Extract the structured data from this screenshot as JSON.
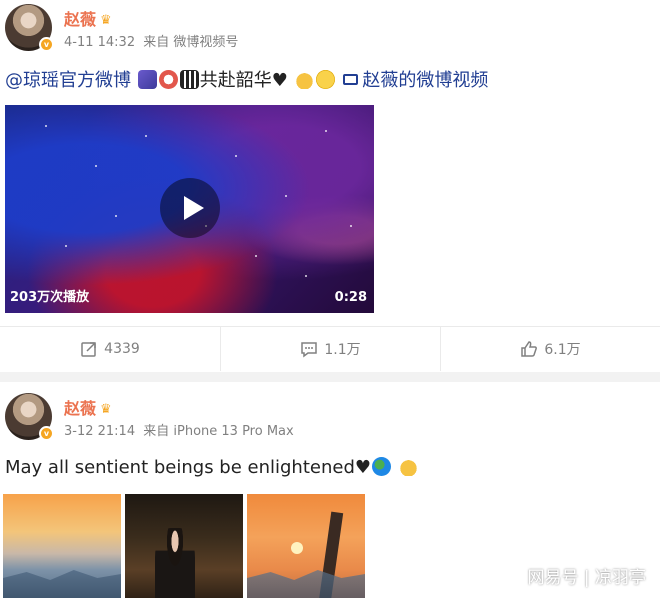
{
  "post1": {
    "author": "赵薇",
    "time": "4-11 14:32",
    "source": "来自 微博视频号",
    "mention": "@琼瑶官方微博",
    "text_main": "共赴韶华♥",
    "video_link": "赵薇的微博视频",
    "video": {
      "play_count": "203万次播放",
      "duration": "0:28"
    },
    "actions": {
      "repost": "4339",
      "comment": "1.1万",
      "like": "6.1万"
    }
  },
  "post2": {
    "author": "赵薇",
    "time": "3-12 21:14",
    "source": "来自 iPhone 13 Pro Max",
    "text_main": "May all sentient beings be enlightened♥"
  },
  "watermark": "网易号 | 凉羽亭",
  "icons": {
    "verified": "verified-badge-icon",
    "crown": "vip-crown-icon",
    "emoji": [
      "music-emoji-icon",
      "clock-emoji-icon",
      "piano-emoji-icon",
      "pray-emoji-icon",
      "smile-emoji-icon",
      "globe-emoji-icon"
    ]
  },
  "colors": {
    "author_name": "#eb7350",
    "link": "#223f93",
    "meta": "#808080"
  }
}
